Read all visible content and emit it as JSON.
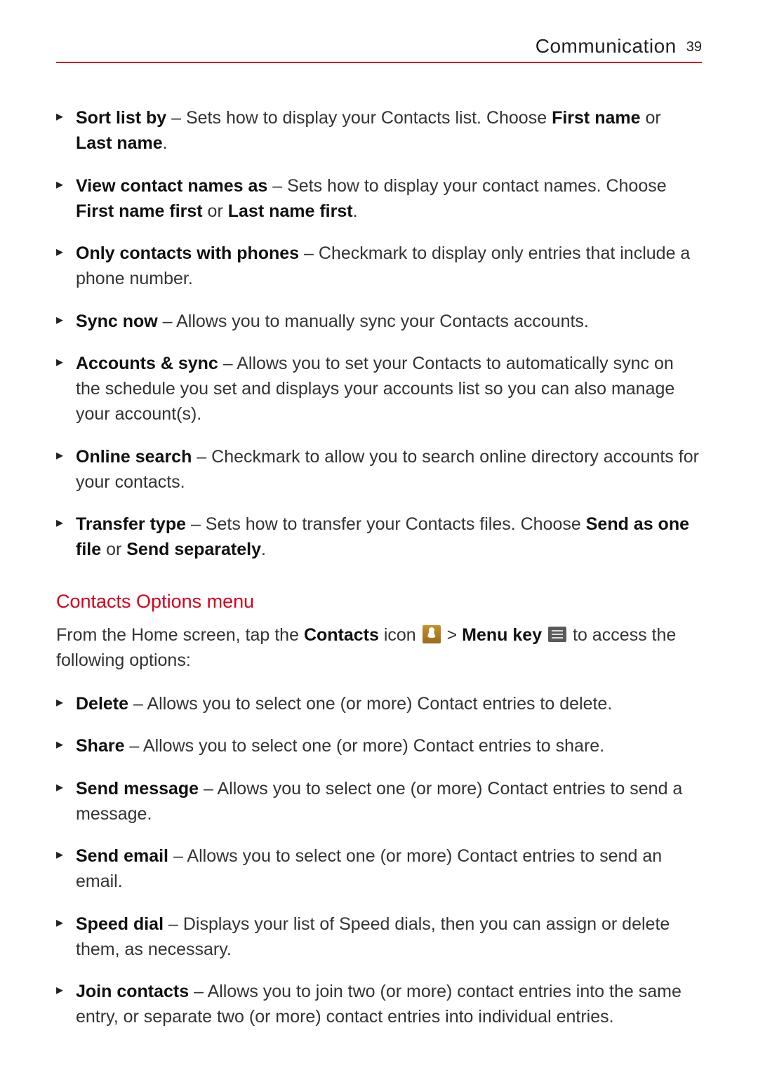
{
  "header": {
    "section": "Communication",
    "page_number": "39"
  },
  "settings_list": [
    {
      "title": "Sort list by",
      "desc_pre": " – Sets how to display your Contacts list. Choose ",
      "bold1": "First name",
      "mid": " or ",
      "bold2": "Last name",
      "desc_post": "."
    },
    {
      "title": "View contact names as",
      "desc_pre": " – Sets how to display your contact names. Choose ",
      "bold1": "First name first",
      "mid": " or ",
      "bold2": "Last name first",
      "desc_post": "."
    },
    {
      "title": "Only contacts with phones",
      "desc_pre": " – Checkmark to display only entries that include a phone number.",
      "bold1": "",
      "mid": "",
      "bold2": "",
      "desc_post": ""
    },
    {
      "title": "Sync now",
      "desc_pre": " – Allows you to manually sync your Contacts accounts.",
      "bold1": "",
      "mid": "",
      "bold2": "",
      "desc_post": ""
    },
    {
      "title": "Accounts & sync",
      "desc_pre": " – Allows you to set your Contacts to automatically sync on the schedule you set and displays your accounts list so you can also manage your account(s).",
      "bold1": "",
      "mid": "",
      "bold2": "",
      "desc_post": ""
    },
    {
      "title": "Online search",
      "desc_pre": " – Checkmark to allow you to search online directory accounts for your contacts.",
      "bold1": "",
      "mid": "",
      "bold2": "",
      "desc_post": ""
    },
    {
      "title": "Transfer type",
      "desc_pre": " – Sets how to transfer your Contacts files. Choose ",
      "bold1": "Send as one file",
      "mid": " or ",
      "bold2": "Send separately",
      "desc_post": "."
    }
  ],
  "options_heading": "Contacts Options menu",
  "intro": {
    "pre": "From the Home screen, tap the ",
    "contacts_bold": "Contacts",
    "icon_word": " icon ",
    "gt": " > ",
    "menu_bold": "Menu key",
    "post": " to access the following options:"
  },
  "options_list": [
    {
      "title": "Delete",
      "desc": " – Allows you to select one (or more) Contact entries to delete."
    },
    {
      "title": "Share",
      "desc": " – Allows you to select one (or more) Contact entries to share."
    },
    {
      "title": "Send message",
      "desc": " – Allows you to select one (or more) Contact entries to send a message."
    },
    {
      "title": "Send email",
      "desc": " – Allows you to select one (or more) Contact entries to send an email."
    },
    {
      "title": "Speed dial",
      "desc": " – Displays your list of Speed dials, then you can assign or delete them, as necessary."
    },
    {
      "title": "Join contacts",
      "desc": " – Allows you to join two (or more) contact entries into the same entry, or separate two (or more) contact entries into individual entries."
    }
  ]
}
